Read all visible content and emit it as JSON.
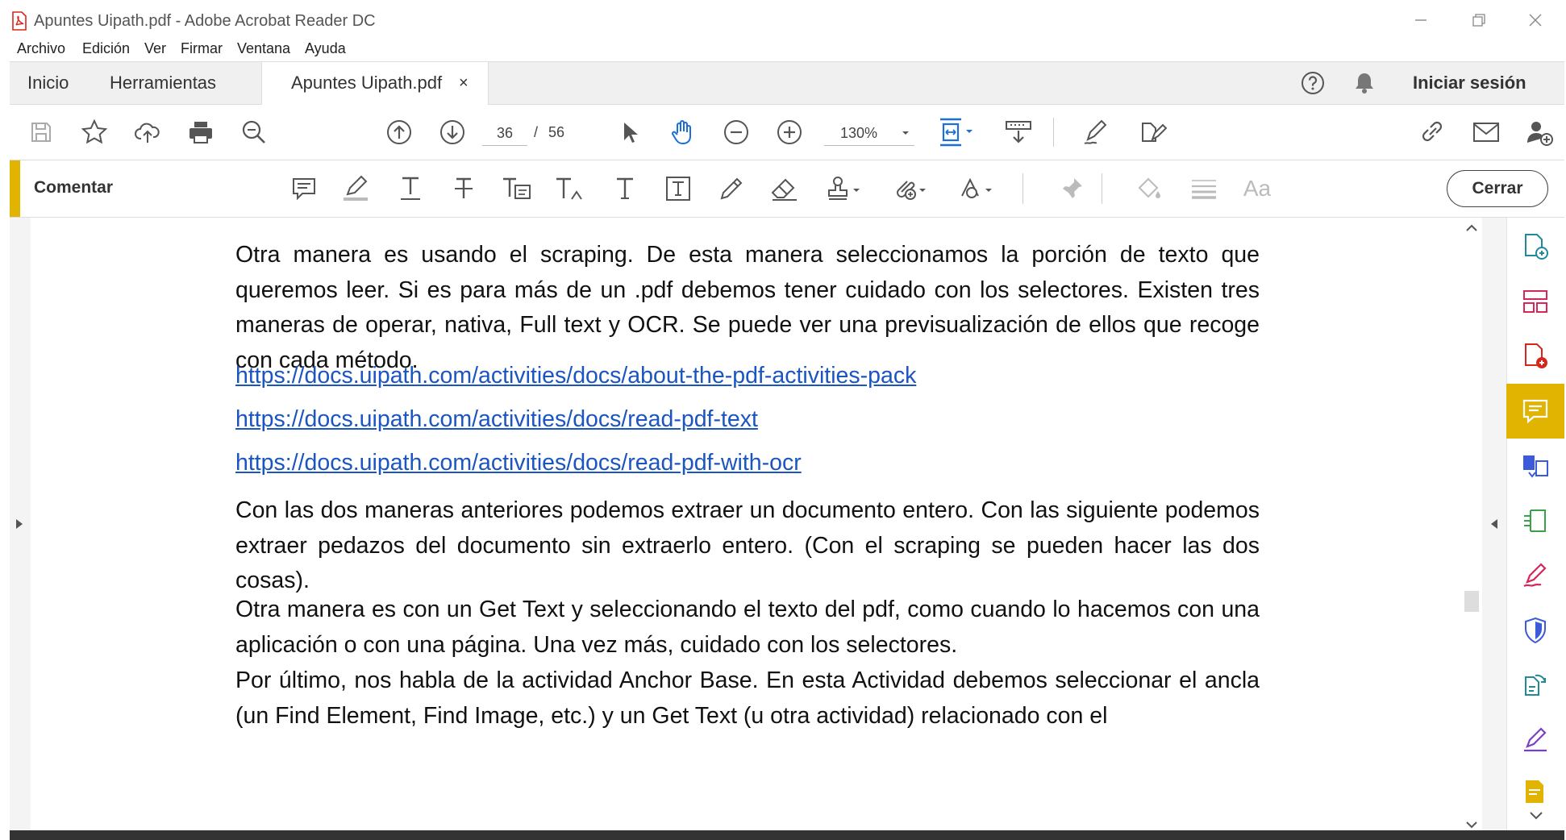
{
  "window": {
    "title": "Apuntes Uipath.pdf - Adobe Acrobat Reader DC"
  },
  "menu": [
    "Archivo",
    "Edición",
    "Ver",
    "Firmar",
    "Ventana",
    "Ayuda"
  ],
  "tabs": {
    "home": "Inicio",
    "tools": "Herramientas",
    "document": "Apuntes Uipath.pdf",
    "close_glyph": "×",
    "sign_in": "Iniciar sesión"
  },
  "toolbar": {
    "current_page": "36",
    "page_separator": "/",
    "total_pages": "56",
    "zoom": "130%"
  },
  "comment_bar": {
    "label": "Comentar",
    "text_tool_glyph": "Aa",
    "close_label": "Cerrar"
  },
  "document": {
    "p1": "Otra manera es usando el scraping. De esta manera seleccionamos la porción de texto que queremos leer. Si es para más de un .pdf debemos tener cuidado con los selectores. Existen tres maneras de operar, nativa, Full text y OCR. Se puede ver una previsualización de ellos que recoge con cada método.",
    "link1": "https://docs.uipath.com/activities/docs/about-the-pdf-activities-pack",
    "link2": "https://docs.uipath.com/activities/docs/read-pdf-text",
    "link3": "https://docs.uipath.com/activities/docs/read-pdf-with-ocr",
    "p2": "Con las dos maneras anteriores podemos extraer un documento entero. Con las siguiente podemos extraer pedazos del documento sin extraerlo entero. (Con el scraping se pueden hacer las dos cosas).",
    "p3": "Otra manera es con un Get Text y seleccionando el texto del pdf, como cuando lo hacemos con una aplicación o con una página. Una vez más, cuidado con los selectores.",
    "p4": "Por último, nos habla de la actividad Anchor Base. En esta Actividad debemos seleccionar el ancla (un Find Element, Find Image, etc.) y un Get Text (u otra actividad) relacionado con el"
  },
  "colors": {
    "accent_comment": "#e0b400",
    "link": "#1a55c0",
    "adobe_red": "#d7261c"
  },
  "icons": {
    "right_tools": [
      "create-pdf-icon",
      "organize-pages-icon",
      "export-pdf-icon",
      "comment-icon",
      "combine-files-icon",
      "compress-pdf-icon",
      "fill-sign-icon",
      "protect-icon",
      "send-review-icon",
      "sign-icon",
      "more-tools-icon"
    ]
  }
}
